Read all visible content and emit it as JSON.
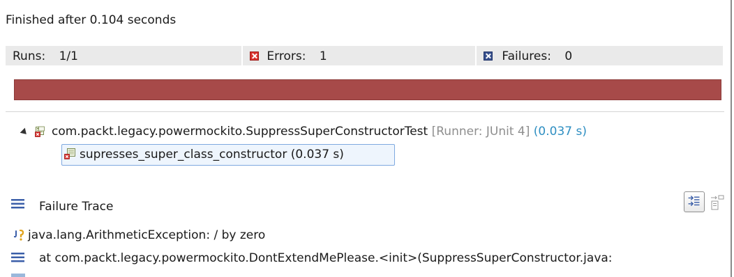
{
  "status": {
    "message": "Finished after 0.104 seconds"
  },
  "counters": {
    "runs_label": "Runs:",
    "runs_value": "1/1",
    "errors_label": "Errors:",
    "errors_value": "1",
    "failures_label": "Failures:",
    "failures_value": "0"
  },
  "progress": {
    "state": "failed",
    "fraction": 1.0,
    "color": "#a74a49"
  },
  "tree": {
    "suite": {
      "name": "com.packt.legacy.powermockito.SuppressSuperConstructorTest",
      "runner": "[Runner: JUnit 4]",
      "time": "(0.037 s)",
      "icon": "test-suite-error-icon"
    },
    "cases": [
      {
        "label": "supresses_super_class_constructor (0.037 s)",
        "icon": "test-case-error-icon",
        "selected": true
      }
    ]
  },
  "failure_trace": {
    "title": "Failure Trace",
    "icon": "stack-trace-icon",
    "lines": [
      {
        "icon": "java-exception-icon",
        "text": "java.lang.ArithmeticException: / by zero"
      },
      {
        "icon": "stack-frame-icon",
        "text": "at com.packt.legacy.powermockito.DontExtendMePlease.<init>(SuppressSuperConstructor.java:"
      }
    ]
  },
  "colors": {
    "error_red": "#d9332f",
    "failure_blue": "#37508d",
    "progress_red": "#a74a49",
    "time_blue": "#2f8fc2"
  }
}
